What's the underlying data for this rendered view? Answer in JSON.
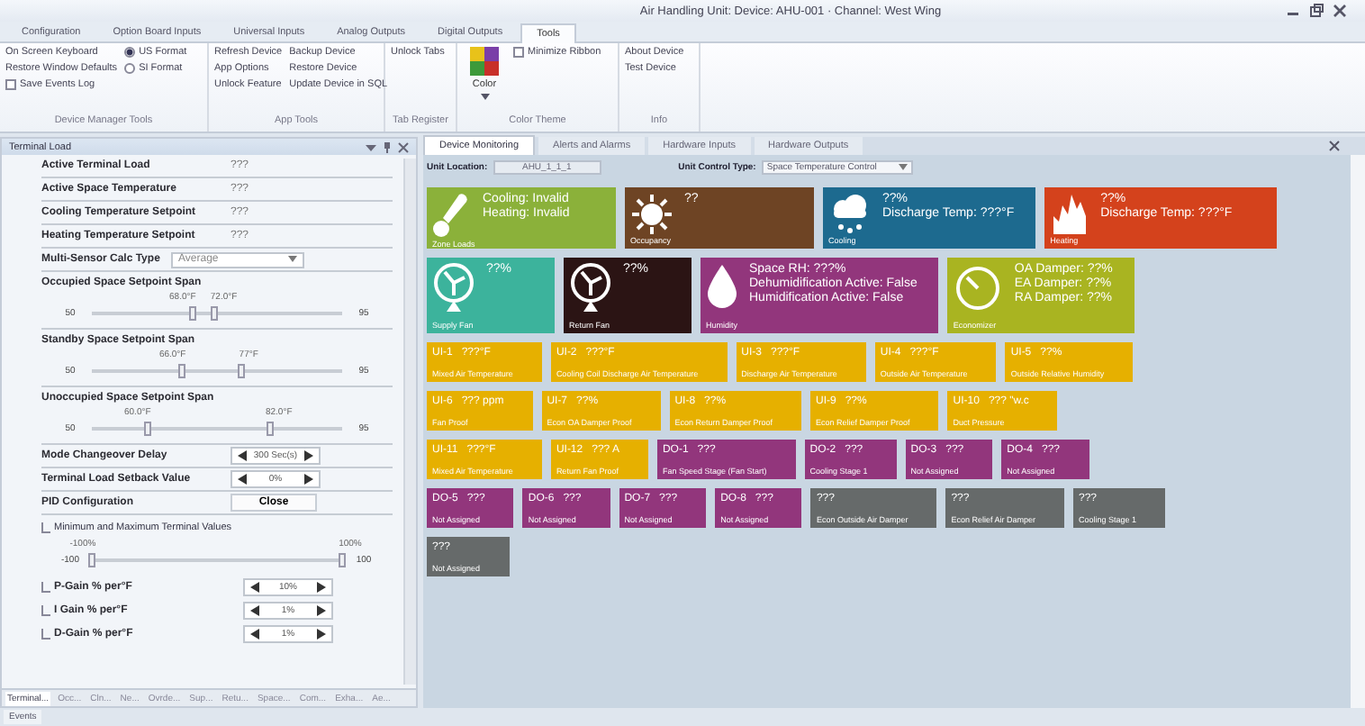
{
  "window": {
    "title": "Air Handling Unit: Device: AHU-001 · Channel: West Wing"
  },
  "ribbon": {
    "tabs": [
      {
        "label": "Configuration",
        "selected": false
      },
      {
        "label": "Option Board Inputs",
        "selected": false
      },
      {
        "label": "Universal Inputs",
        "selected": false
      },
      {
        "label": "Analog Outputs",
        "selected": false
      },
      {
        "label": "Digital Outputs",
        "selected": false
      },
      {
        "label": "Tools",
        "selected": true
      }
    ],
    "groups": [
      {
        "label": "Device Manager Tools",
        "columns": [
          [
            {
              "kind": "command",
              "label": "On Screen Keyboard"
            },
            {
              "kind": "command",
              "label": "Restore Window Defaults"
            },
            {
              "kind": "checkbox",
              "label": "Save Events Log",
              "checked": false
            }
          ],
          [
            {
              "kind": "radio",
              "label": "US Format",
              "selected": true
            },
            {
              "kind": "radio",
              "label": "SI Format",
              "selected": false
            }
          ]
        ]
      },
      {
        "label": "App Tools",
        "columns": [
          [
            {
              "kind": "command",
              "label": "Refresh Device"
            },
            {
              "kind": "command",
              "label": "App Options"
            },
            {
              "kind": "command",
              "label": "Unlock Feature"
            }
          ],
          [
            {
              "kind": "command",
              "label": "Backup Device"
            },
            {
              "kind": "command",
              "label": "Restore Device"
            },
            {
              "kind": "command",
              "label": "Update Device in SQL"
            }
          ]
        ]
      },
      {
        "label": "Tab Register",
        "columns": [
          [
            {
              "kind": "command",
              "label": "Unlock Tabs"
            }
          ]
        ]
      },
      {
        "label": "Color Theme",
        "columns": [
          [
            {
              "kind": "color",
              "label": "Color"
            }
          ],
          [
            {
              "kind": "checkbox",
              "label": "Minimize Ribbon",
              "checked": false
            }
          ]
        ]
      },
      {
        "label": "Info",
        "columns": [
          [
            {
              "kind": "command",
              "label": "About Device"
            },
            {
              "kind": "command",
              "label": "Test Device"
            }
          ]
        ]
      }
    ]
  },
  "left_panel": {
    "title": "Terminal Load",
    "rows": [
      {
        "kind": "readout",
        "label": "Active Terminal Load",
        "value": "???"
      },
      {
        "kind": "readout",
        "label": "Active Space Temperature",
        "value": "???"
      },
      {
        "kind": "readout",
        "label": "Cooling Temperature Setpoint",
        "value": "???"
      },
      {
        "kind": "readout",
        "label": "Heating Temperature Setpoint",
        "value": "???"
      },
      {
        "kind": "dropdown",
        "label": "Multi-Sensor Calc Type",
        "value": "Average"
      },
      {
        "kind": "range",
        "label": "Occupied Space Setpoint Span",
        "min": "50",
        "max": "95",
        "thumbs": [
          {
            "label": "68.0°F",
            "level": 0.4
          },
          {
            "label": "72.0°F",
            "level": 0.49
          }
        ]
      },
      {
        "kind": "range",
        "label": "Standby Space Setpoint Span",
        "min": "50",
        "max": "95",
        "thumbs": [
          {
            "label": "66.0°F",
            "level": 0.36
          },
          {
            "label": "77°F",
            "level": 0.6
          }
        ]
      },
      {
        "kind": "range",
        "label": "Unoccupied Space Setpoint Span",
        "min": "50",
        "max": "95",
        "thumbs": [
          {
            "label": "60.0°F",
            "level": 0.22
          },
          {
            "label": "82.0°F",
            "level": 0.71
          }
        ]
      },
      {
        "kind": "spinner",
        "label": "Mode Changeover Delay",
        "value": "300 Sec(s)"
      },
      {
        "kind": "spinner",
        "label": "Terminal Load Setback Value",
        "value": "0%"
      },
      {
        "kind": "button",
        "label": "PID Configuration",
        "value": "Close"
      },
      {
        "kind": "note",
        "label": "Minimum and Maximum Terminal Values"
      },
      {
        "kind": "range",
        "label": "",
        "min": "-100",
        "max": "100",
        "thumbs": [
          {
            "label": "-100%",
            "level": 0
          },
          {
            "label": "100%",
            "level": 1
          }
        ]
      },
      {
        "kind": "subspinner",
        "label": "P-Gain % per°F",
        "value": "10%"
      },
      {
        "kind": "subspinner",
        "label": "I Gain % per°F",
        "value": "1%"
      },
      {
        "kind": "subspinner",
        "label": "D-Gain % per°F",
        "value": "1%"
      }
    ],
    "tabs": [
      {
        "label": "Terminal...",
        "selected": true
      },
      {
        "label": "Occ...",
        "selected": false
      },
      {
        "label": "Cln...",
        "selected": false
      },
      {
        "label": "Ne...",
        "selected": false
      },
      {
        "label": "Ovrde...",
        "selected": false
      },
      {
        "label": "Sup...",
        "selected": false
      },
      {
        "label": "Retu...",
        "selected": false
      },
      {
        "label": "Space...",
        "selected": false
      },
      {
        "label": "Com...",
        "selected": false
      },
      {
        "label": "Exha...",
        "selected": false
      },
      {
        "label": "Ae...",
        "selected": false
      }
    ]
  },
  "events_tab": "Events",
  "document": {
    "tabs": [
      {
        "label": "Device Monitoring",
        "selected": true
      },
      {
        "label": "Alerts and Alarms",
        "selected": false
      },
      {
        "label": "Hardware Inputs",
        "selected": false
      },
      {
        "label": "Hardware Outputs",
        "selected": false
      }
    ],
    "unit_location": {
      "label": "Unit Location:",
      "value": "AHU_1_1_1"
    },
    "unit_control_type": {
      "label": "Unit Control Type:",
      "value": "Space Temperature Control"
    },
    "tile_rows": [
      [
        {
          "kind": "zone-loads",
          "color": "#8bb13a",
          "lines": [
            "Cooling: Invalid",
            "Heating: Invalid"
          ],
          "caption": "Zone Loads"
        },
        {
          "kind": "occupancy",
          "color": "#6e4424",
          "lines": [
            "??"
          ],
          "caption": "Occupancy"
        },
        {
          "kind": "cooling",
          "color": "#1d6a8f",
          "lines": [
            "??%",
            "Discharge Temp: ???°F"
          ],
          "caption": "Cooling"
        },
        {
          "kind": "heating",
          "color": "#d4421c",
          "lines": [
            "??%",
            "Discharge Temp: ???°F"
          ],
          "caption": "Heating"
        }
      ],
      [
        {
          "kind": "fan",
          "color": "#3cb39c",
          "lines": [
            "??%"
          ],
          "caption": "Supply Fan"
        },
        {
          "kind": "fan",
          "color": "#2b1414",
          "lines": [
            "??%"
          ],
          "caption": "Return Fan"
        },
        {
          "kind": "humidity",
          "color": "#92367c",
          "lines": [
            "Space RH: ???%",
            "Dehumidification Active: False",
            "Humidification Active: False"
          ],
          "caption": "Humidity"
        },
        {
          "kind": "economizer",
          "color": "#a9b421",
          "lines": [
            "OA Damper: ??%",
            "EA Damper: ??%",
            "RA Damper: ??%"
          ],
          "caption": "Economizer"
        }
      ],
      [
        {
          "kind": "point",
          "color": "#e6b000",
          "lines": [
            "UI-1   ???°F"
          ],
          "caption": "Mixed Air Temperature"
        },
        {
          "kind": "point",
          "color": "#e6b000",
          "lines": [
            "UI-2   ???°F"
          ],
          "caption": "Cooling Coil Discharge Air Temperature"
        },
        {
          "kind": "point",
          "color": "#e6b000",
          "lines": [
            "UI-3   ???°F"
          ],
          "caption": "Discharge Air Temperature"
        },
        {
          "kind": "point",
          "color": "#e6b000",
          "lines": [
            "UI-4   ???°F"
          ],
          "caption": "Outside Air Temperature"
        },
        {
          "kind": "point",
          "color": "#e6b000",
          "lines": [
            "UI-5   ??%"
          ],
          "caption": "Outside Relative Humidity"
        }
      ],
      [
        {
          "kind": "point",
          "color": "#e6b000",
          "lines": [
            "UI-6   ??? ppm"
          ],
          "caption": "Fan Proof"
        },
        {
          "kind": "point",
          "color": "#e6b000",
          "lines": [
            "UI-7   ??%"
          ],
          "caption": "Econ OA Damper Proof"
        },
        {
          "kind": "point",
          "color": "#e6b000",
          "lines": [
            "UI-8   ??%"
          ],
          "caption": "Econ Return Damper Proof"
        },
        {
          "kind": "point",
          "color": "#e6b000",
          "lines": [
            "UI-9   ??%"
          ],
          "caption": "Econ Relief Damper Proof"
        },
        {
          "kind": "point",
          "color": "#e6b000",
          "lines": [
            "UI-10   ??? \"w.c"
          ],
          "caption": "Duct Pressure"
        }
      ],
      [
        {
          "kind": "point",
          "color": "#e6b000",
          "lines": [
            "UI-11   ???°F"
          ],
          "caption": "Mixed Air Temperature"
        },
        {
          "kind": "point",
          "color": "#e6b000",
          "lines": [
            "UI-12   ??? A"
          ],
          "caption": "Return Fan Proof"
        },
        {
          "kind": "point",
          "color": "#92367c",
          "lines": [
            "DO-1   ???"
          ],
          "caption": "Fan Speed Stage (Fan Start)"
        },
        {
          "kind": "point",
          "color": "#92367c",
          "lines": [
            "DO-2   ???"
          ],
          "caption": "Cooling Stage 1"
        },
        {
          "kind": "point",
          "color": "#92367c",
          "lines": [
            "DO-3   ???"
          ],
          "caption": "Not Assigned"
        },
        {
          "kind": "point",
          "color": "#92367c",
          "lines": [
            "DO-4   ???"
          ],
          "caption": "Not Assigned"
        }
      ],
      [
        {
          "kind": "point",
          "color": "#92367c",
          "lines": [
            "DO-5   ???"
          ],
          "caption": "Not Assigned"
        },
        {
          "kind": "point",
          "color": "#92367c",
          "lines": [
            "DO-6   ???"
          ],
          "caption": "Not Assigned"
        },
        {
          "kind": "point",
          "color": "#92367c",
          "lines": [
            "DO-7   ???"
          ],
          "caption": "Not Assigned"
        },
        {
          "kind": "point",
          "color": "#92367c",
          "lines": [
            "DO-8   ???"
          ],
          "caption": "Not Assigned"
        },
        {
          "kind": "point",
          "color": "#666a6a",
          "lines": [
            "???"
          ],
          "caption": "Econ Outside Air Damper"
        },
        {
          "kind": "point",
          "color": "#666a6a",
          "lines": [
            "???"
          ],
          "caption": "Econ Relief Air Damper"
        },
        {
          "kind": "point",
          "color": "#666a6a",
          "lines": [
            "???"
          ],
          "caption": "Cooling Stage 1"
        }
      ],
      [
        {
          "kind": "point",
          "color": "#666a6a",
          "lines": [
            "???"
          ],
          "caption": "Not Assigned"
        }
      ]
    ]
  }
}
